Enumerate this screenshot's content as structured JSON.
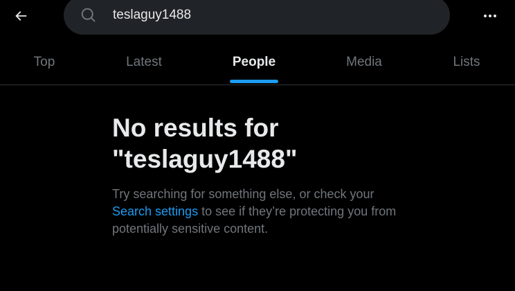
{
  "header": {
    "back_icon": "arrow-left-icon",
    "search": {
      "icon": "search-icon",
      "value": "teslaguy1488"
    },
    "more_icon": "more-horizontal-icon"
  },
  "tabs": [
    {
      "label": "Top",
      "active": false
    },
    {
      "label": "Latest",
      "active": false
    },
    {
      "label": "People",
      "active": true
    },
    {
      "label": "Media",
      "active": false
    },
    {
      "label": "Lists",
      "active": false
    }
  ],
  "empty_state": {
    "title_line1": "No results for",
    "title_line2": "\"teslaguy1488\"",
    "desc_before": "Try searching for something else, or check your ",
    "link_text": "Search settings",
    "desc_after": " to see if they’re protecting you from potentially sensitive content."
  },
  "colors": {
    "background": "#000000",
    "accent": "#1d9bf0",
    "primary_text": "#e7e9ea",
    "secondary_text": "#71767b",
    "search_bg": "#202327"
  }
}
